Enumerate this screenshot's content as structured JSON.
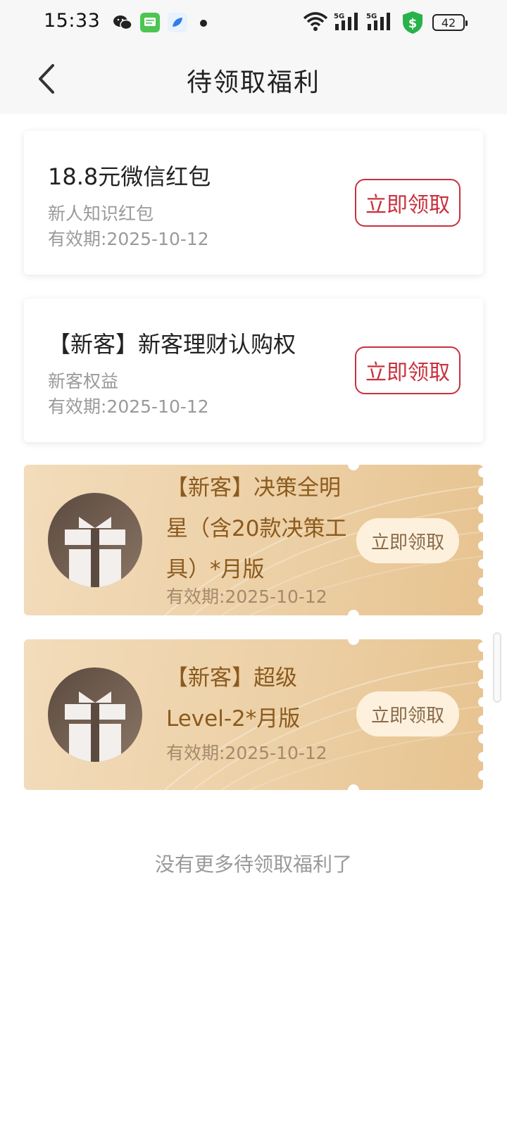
{
  "status_bar": {
    "time": "15:33",
    "battery": "42",
    "icons": [
      "wechat-icon",
      "message-icon",
      "app-icon",
      "dot-icon",
      "wifi-icon",
      "signal-5g-icon",
      "signal-5g-icon",
      "security-shield-icon",
      "battery-icon"
    ]
  },
  "nav": {
    "title": "待领取福利"
  },
  "cards": [
    {
      "title": "18.8元微信红包",
      "subtitle": "新人知识红包",
      "validity": "有效期:2025-10-12",
      "button": "立即领取"
    },
    {
      "title": "【新客】新客理财认购权",
      "subtitle": "新客权益",
      "validity": "有效期:2025-10-12",
      "button": "立即领取"
    }
  ],
  "vouchers": [
    {
      "title": "【新客】决策全明星（含20款决策工具）*月版",
      "validity": "有效期:2025-10-12",
      "button": "立即领取"
    },
    {
      "title": "【新客】超级Level-2*月版",
      "validity": "有效期:2025-10-12",
      "button": "立即领取"
    }
  ],
  "footer_text": "没有更多待领取福利了",
  "colors": {
    "accent_red": "#c8313e",
    "gold_text": "#8c5a1d",
    "muted": "#9a9a9a"
  }
}
